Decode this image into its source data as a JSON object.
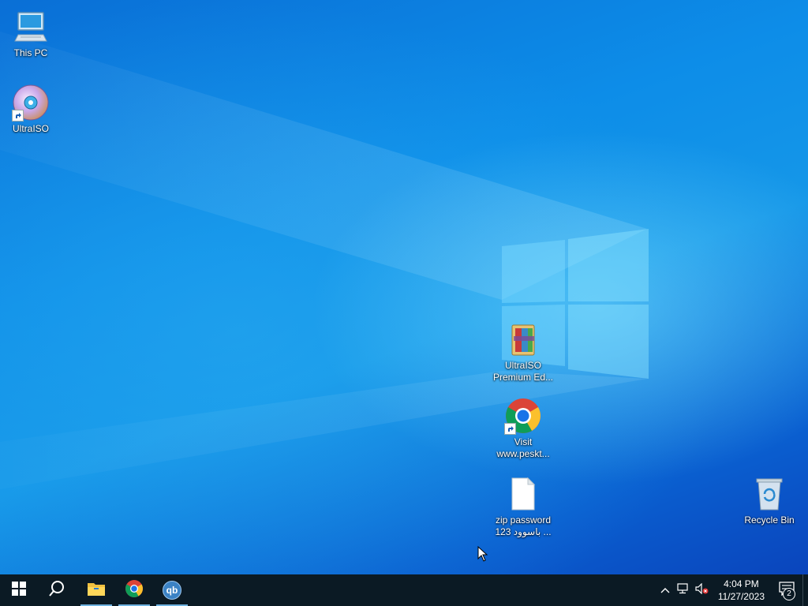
{
  "desktop": {
    "icons": [
      {
        "label": "This PC",
        "icon": "monitor-icon"
      },
      {
        "label": "UltraISO",
        "icon": "disc-icon"
      },
      {
        "label_line1": "UltraISO",
        "label_line2": "Premium Ed...",
        "icon": "winrar-archive-icon"
      },
      {
        "label_line1": "Visit",
        "label_line2": "www.peskt...",
        "icon": "chrome-icon"
      },
      {
        "label_line1": "zip password",
        "label_line2": "باسوود 123 ...",
        "icon": "text-file-icon"
      },
      {
        "label": "Recycle Bin",
        "icon": "recycle-bin-icon"
      }
    ]
  },
  "taskbar": {
    "start": "windows-logo-icon",
    "search": "search-icon",
    "apps": [
      "file-explorer-icon",
      "chrome-icon",
      "qbittorrent-icon"
    ],
    "qbittorrent_text": "qb",
    "tray": {
      "time": "4:04 PM",
      "date": "11/27/2023",
      "notification_count": "2"
    }
  },
  "colors": {
    "taskbar_bg": "#0b1a24",
    "desktop_accent": "#0d8de8"
  }
}
